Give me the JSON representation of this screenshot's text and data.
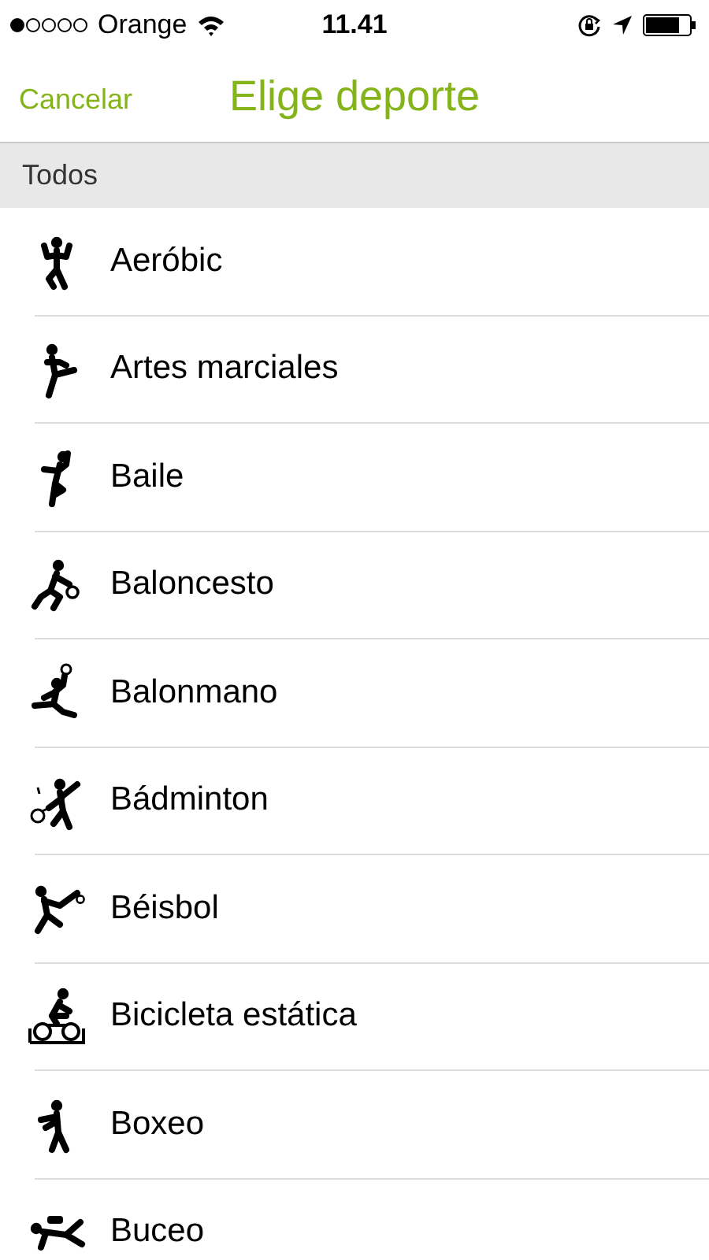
{
  "status_bar": {
    "carrier": "Orange",
    "time": "11.41"
  },
  "nav": {
    "cancel": "Cancelar",
    "title": "Elige deporte"
  },
  "section": {
    "title": "Todos"
  },
  "sports": [
    {
      "label": "Aeróbic"
    },
    {
      "label": "Artes marciales"
    },
    {
      "label": "Baile"
    },
    {
      "label": "Baloncesto"
    },
    {
      "label": "Balonmano"
    },
    {
      "label": "Bádminton"
    },
    {
      "label": "Béisbol"
    },
    {
      "label": "Bicicleta estática"
    },
    {
      "label": "Boxeo"
    },
    {
      "label": "Buceo"
    }
  ]
}
